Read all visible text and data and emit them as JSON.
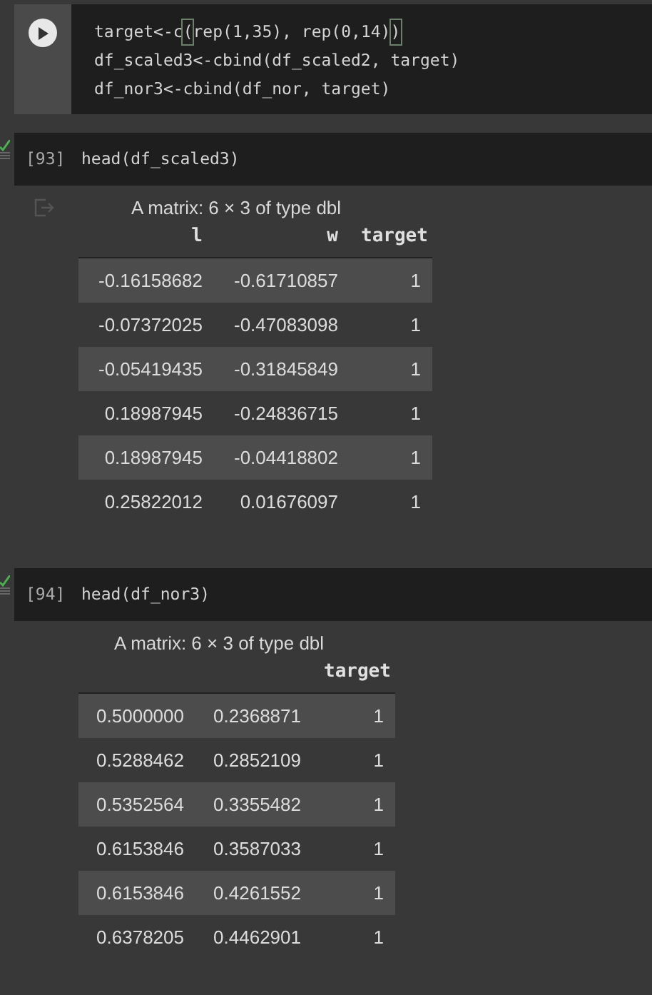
{
  "cells": [
    {
      "kind": "runnable",
      "lines": [
        [
          {
            "text": "target<-c",
            "bracket_match": false
          },
          {
            "text": "(",
            "bracket_match": true
          },
          {
            "text": "rep(1,35), rep(0,14)",
            "bracket_match": false
          },
          {
            "text": ")",
            "bracket_match": true
          }
        ],
        [
          {
            "text": "df_scaled3<-cbind(df_scaled2, target)",
            "bracket_match": false
          }
        ],
        [
          {
            "text": "df_nor3<-cbind(df_nor, target)",
            "bracket_match": false
          }
        ]
      ]
    },
    {
      "kind": "executed",
      "count": "[93]",
      "lines": [
        [
          {
            "text": "head(df_scaled3)",
            "bracket_match": false
          }
        ]
      ],
      "output": {
        "output_icon": true,
        "caption": "A matrix: 6 × 3 of type dbl",
        "headers": [
          "l",
          "w",
          "target"
        ],
        "rows": [
          [
            "-0.16158682",
            "-0.61710857",
            "1"
          ],
          [
            "-0.07372025",
            "-0.47083098",
            "1"
          ],
          [
            "-0.05419435",
            "-0.31845849",
            "1"
          ],
          [
            "0.18987945",
            "-0.24836715",
            "1"
          ],
          [
            "0.18987945",
            "-0.04418802",
            "1"
          ],
          [
            "0.25822012",
            "0.01676097",
            "1"
          ]
        ]
      }
    },
    {
      "kind": "executed",
      "count": "[94]",
      "lines": [
        [
          {
            "text": "head(df_nor3)",
            "bracket_match": false
          }
        ]
      ],
      "output": {
        "caption": "A matrix: 6 × 3 of type dbl",
        "headers": [
          "target"
        ],
        "rows": [
          [
            "0.5000000",
            "0.2368871",
            "1"
          ],
          [
            "0.5288462",
            "0.2852109",
            "1"
          ],
          [
            "0.5352564",
            "0.3355482",
            "1"
          ],
          [
            "0.6153846",
            "0.3587033",
            "1"
          ],
          [
            "0.6153846",
            "0.4261552",
            "1"
          ],
          [
            "0.6378205",
            "0.4462901",
            "1"
          ]
        ]
      }
    }
  ]
}
